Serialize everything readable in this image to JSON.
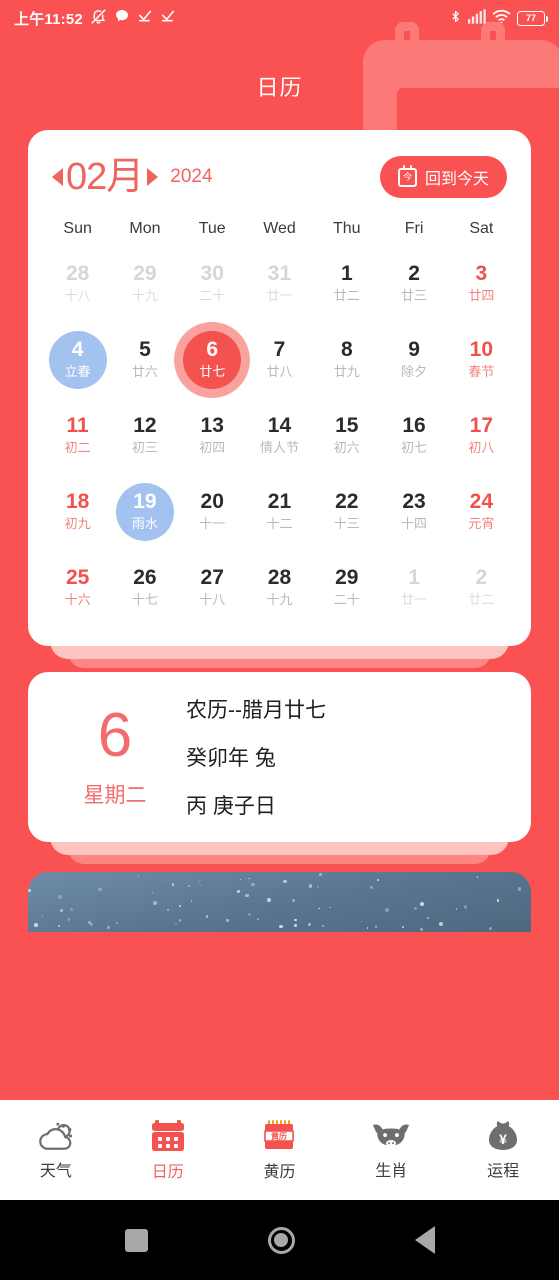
{
  "statusbar": {
    "time": "上午11:52",
    "battery_level": "77",
    "icons_left": [
      "bell-muted-icon",
      "chat-bubble-icon",
      "check-icon",
      "check-icon"
    ],
    "icons_right": [
      "bluetooth-icon",
      "signal-bars-icon",
      "wifi-icon",
      "battery-icon"
    ]
  },
  "header": {
    "title": "日历"
  },
  "calendar": {
    "month_label": "02月",
    "year_label": "2024",
    "prev_icon": "chevron-left-icon",
    "next_icon": "chevron-right-icon",
    "today_button": {
      "label": "回到今天",
      "icon": "calendar-today-icon",
      "glyph": "今"
    },
    "weekdays": [
      "Sun",
      "Mon",
      "Tue",
      "Wed",
      "Thu",
      "Fri",
      "Sat"
    ],
    "weeks": [
      [
        {
          "day": "28",
          "lunar": "十八",
          "style": "muted"
        },
        {
          "day": "29",
          "lunar": "十九",
          "style": "muted"
        },
        {
          "day": "30",
          "lunar": "二十",
          "style": "muted"
        },
        {
          "day": "31",
          "lunar": "廿一",
          "style": "muted"
        },
        {
          "day": "1",
          "lunar": "廿二",
          "style": "normal"
        },
        {
          "day": "2",
          "lunar": "廿三",
          "style": "normal"
        },
        {
          "day": "3",
          "lunar": "廿四",
          "style": "red"
        }
      ],
      [
        {
          "day": "4",
          "lunar": "立春",
          "style": "term"
        },
        {
          "day": "5",
          "lunar": "廿六",
          "style": "normal"
        },
        {
          "day": "6",
          "lunar": "廿七",
          "style": "selected"
        },
        {
          "day": "7",
          "lunar": "廿八",
          "style": "normal"
        },
        {
          "day": "8",
          "lunar": "廿九",
          "style": "normal"
        },
        {
          "day": "9",
          "lunar": "除夕",
          "style": "normal"
        },
        {
          "day": "10",
          "lunar": "春节",
          "style": "red"
        }
      ],
      [
        {
          "day": "11",
          "lunar": "初二",
          "style": "red"
        },
        {
          "day": "12",
          "lunar": "初三",
          "style": "normal"
        },
        {
          "day": "13",
          "lunar": "初四",
          "style": "normal"
        },
        {
          "day": "14",
          "lunar": "情人节",
          "style": "normal"
        },
        {
          "day": "15",
          "lunar": "初六",
          "style": "normal"
        },
        {
          "day": "16",
          "lunar": "初七",
          "style": "normal"
        },
        {
          "day": "17",
          "lunar": "初八",
          "style": "red"
        }
      ],
      [
        {
          "day": "18",
          "lunar": "初九",
          "style": "red"
        },
        {
          "day": "19",
          "lunar": "雨水",
          "style": "term"
        },
        {
          "day": "20",
          "lunar": "十一",
          "style": "normal"
        },
        {
          "day": "21",
          "lunar": "十二",
          "style": "normal"
        },
        {
          "day": "22",
          "lunar": "十三",
          "style": "normal"
        },
        {
          "day": "23",
          "lunar": "十四",
          "style": "normal"
        },
        {
          "day": "24",
          "lunar": "元宵",
          "style": "red"
        }
      ],
      [
        {
          "day": "25",
          "lunar": "十六",
          "style": "red"
        },
        {
          "day": "26",
          "lunar": "十七",
          "style": "normal"
        },
        {
          "day": "27",
          "lunar": "十八",
          "style": "normal"
        },
        {
          "day": "28",
          "lunar": "十九",
          "style": "normal"
        },
        {
          "day": "29",
          "lunar": "二十",
          "style": "normal"
        },
        {
          "day": "1",
          "lunar": "廿一",
          "style": "muted"
        },
        {
          "day": "2",
          "lunar": "廿二",
          "style": "muted"
        }
      ]
    ]
  },
  "detail": {
    "day": "6",
    "weekday": "星期二",
    "lines": [
      "农历--腊月廿七",
      "癸卯年  兔",
      "丙  庚子日"
    ]
  },
  "tabbar": [
    {
      "label": "天气",
      "icon": "cloud-sun-icon",
      "active": false
    },
    {
      "label": "日历",
      "icon": "calendar-icon",
      "active": true
    },
    {
      "label": "黄历",
      "icon": "almanac-icon",
      "active": false,
      "glyph": "黄历"
    },
    {
      "label": "生肖",
      "icon": "ox-head-icon",
      "active": false
    },
    {
      "label": "运程",
      "icon": "money-bag-icon",
      "active": false
    }
  ],
  "navbar": [
    {
      "name": "recents",
      "icon": "square-icon"
    },
    {
      "name": "home",
      "icon": "circle-icon"
    },
    {
      "name": "back",
      "icon": "triangle-left-icon"
    }
  ],
  "colors": {
    "brand_red": "#FA5252",
    "accent_red": "#F0645F",
    "selected_red": "#F3524F",
    "selected_ring": "#F9A29E",
    "term_blue": "#A4C2F0",
    "muted_gray": "#D6D6D6"
  }
}
